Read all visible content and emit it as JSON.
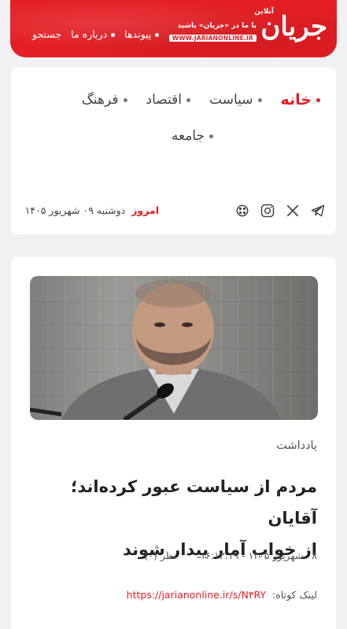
{
  "header": {
    "logo_text": "جریان",
    "logo_superscript": "آنلاین",
    "tagline": "با ما در «جریان» باشید",
    "site_url": "WWW.JARIANONLINE.IR",
    "nav": [
      {
        "label": "جستجو"
      },
      {
        "label": "درباره ما"
      },
      {
        "label": "پیوندها"
      }
    ]
  },
  "menu": {
    "items": [
      {
        "label": "خانه",
        "active": true
      },
      {
        "label": "سیاست"
      },
      {
        "label": "اقتصاد"
      },
      {
        "label": "فرهنگ"
      },
      {
        "label": "جامعه"
      }
    ]
  },
  "date_bar": {
    "today_label": "امروز",
    "date_text": "دوشنبه ۰۹ شهریور ۱۴۰۵"
  },
  "social": {
    "icons": [
      "telegram-icon",
      "x-icon",
      "instagram-icon",
      "aparat-icon"
    ]
  },
  "article": {
    "category": "یادداشت",
    "headline_line1": "مردم از سیاست عبور کرده‌اند؛ آقایان",
    "headline_line2": "از خواب آمار بیدار شوند",
    "datetime": "۰۸ شهریور ۱۴۰۵ - ۱۶:۱۳:۱۹",
    "comments": "نظر (۰)",
    "short_link_label": "لینک کوتاه:",
    "short_link_url": "https://jarianonline.ir/s/N۳RY"
  },
  "colors": {
    "brand": "#e31e24",
    "background": "#f1f1f3",
    "card": "#ffffff"
  }
}
